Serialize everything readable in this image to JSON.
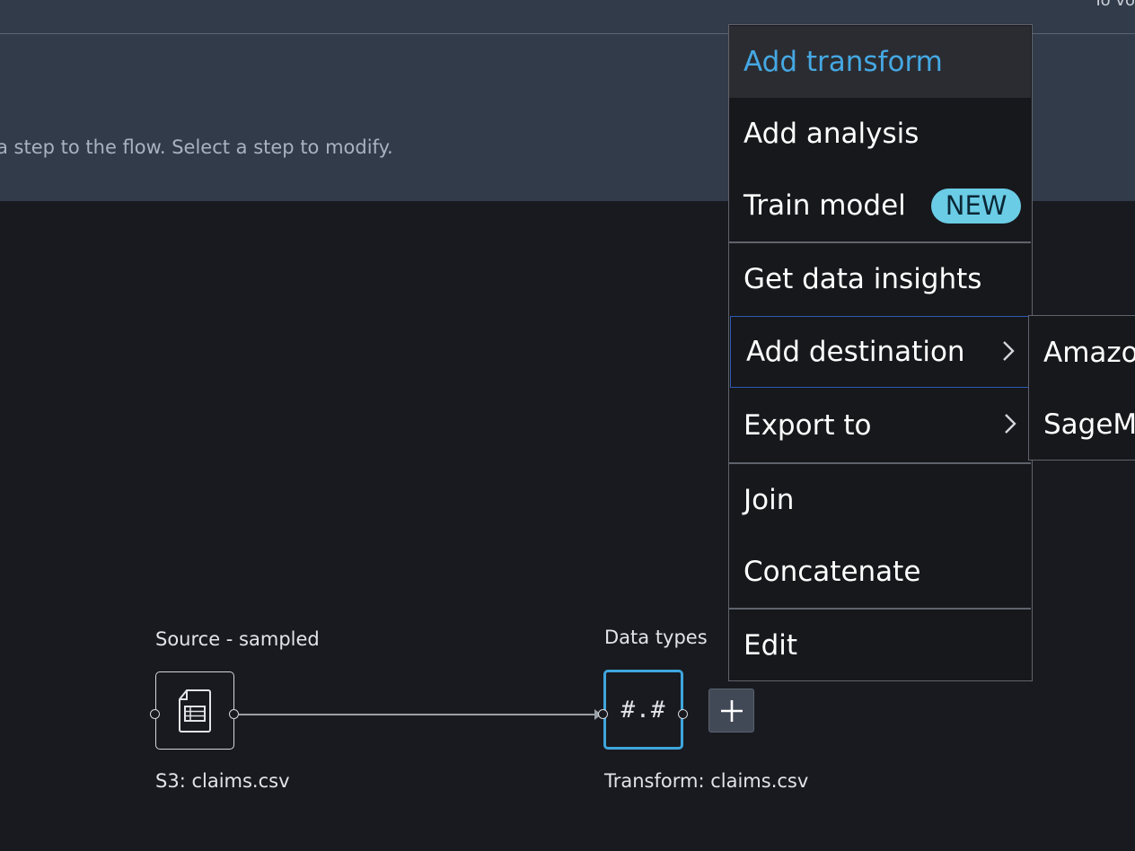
{
  "header": {
    "partial_text": "To vo"
  },
  "info_panel": {
    "hint_text": "a step to the flow. Select a step to modify."
  },
  "flow": {
    "source_node": {
      "label": "Source - sampled",
      "caption": "S3: claims.csv",
      "icon": "csv-file-icon"
    },
    "transform_node": {
      "label": "Data types",
      "caption": "Transform: claims.csv",
      "glyph": "#.#"
    },
    "add_step_icon": "plus-icon"
  },
  "context_menu": {
    "add_transform": "Add transform",
    "add_analysis": "Add analysis",
    "train_model": "Train model",
    "train_model_badge": "NEW",
    "get_data_insights": "Get data insights",
    "add_destination": "Add destination",
    "export_to": "Export to",
    "join": "Join",
    "concatenate": "Concatenate",
    "edit": "Edit"
  },
  "destination_submenu": {
    "items": [
      "Amazo",
      "SageMa"
    ]
  },
  "colors": {
    "accent": "#45a8e3",
    "badge": "#6bcce6",
    "selected_node_border": "#3fa6dd",
    "panel": "#323b4a",
    "canvas": "#191a1f"
  }
}
